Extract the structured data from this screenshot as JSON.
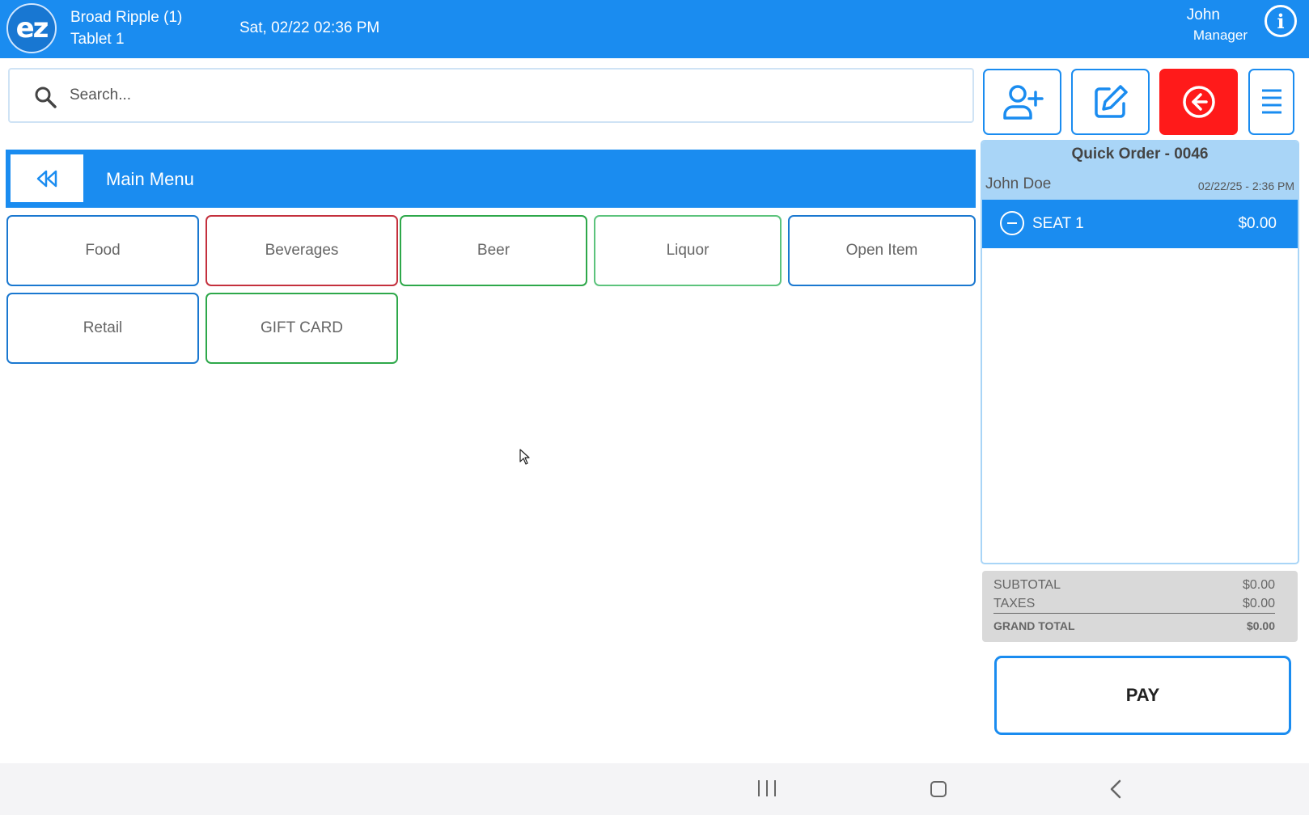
{
  "header": {
    "logo_text": "ez",
    "location_name": "Broad Ripple (1)",
    "device_name": "Tablet 1",
    "datetime": "Sat, 02/22 02:36 PM",
    "user_name": "John",
    "user_role": "Manager",
    "info_icon": "info-icon"
  },
  "search": {
    "placeholder": "Search..."
  },
  "actions": {
    "add_customer_icon": "user-plus-icon",
    "edit_icon": "edit-icon",
    "exit_icon": "arrow-left-circle-icon",
    "menu_icon": "hamburger-icon",
    "exit_color": "#ff1a1a"
  },
  "menu": {
    "title": "Main Menu",
    "back_icon": "double-chevron-left-icon",
    "categories": [
      {
        "label": "Food",
        "color": "#1a78d0"
      },
      {
        "label": "Beverages",
        "color": "#c4303d"
      },
      {
        "label": "Beer",
        "color": "#2ea84a"
      },
      {
        "label": "Liquor",
        "color": "#5cc37c"
      },
      {
        "label": "Open Item",
        "color": "#1a78d0"
      },
      {
        "label": "Retail",
        "color": "#1a78d0"
      },
      {
        "label": "GIFT CARD",
        "color": "#2ea84a"
      }
    ]
  },
  "order": {
    "title": "Quick Order - 0046",
    "customer": "John Doe",
    "timestamp": "02/22/25  - 2:36 PM",
    "seats": [
      {
        "label": "SEAT 1",
        "amount": "$0.00"
      }
    ]
  },
  "totals": {
    "subtotal_label": "SUBTOTAL",
    "subtotal": "$0.00",
    "taxes_label": "TAXES",
    "taxes": "$0.00",
    "grand_total_label": "GRAND TOTAL",
    "grand_total": "$0.00"
  },
  "pay": {
    "label": "PAY"
  },
  "accent_color": "#1a8cf0"
}
